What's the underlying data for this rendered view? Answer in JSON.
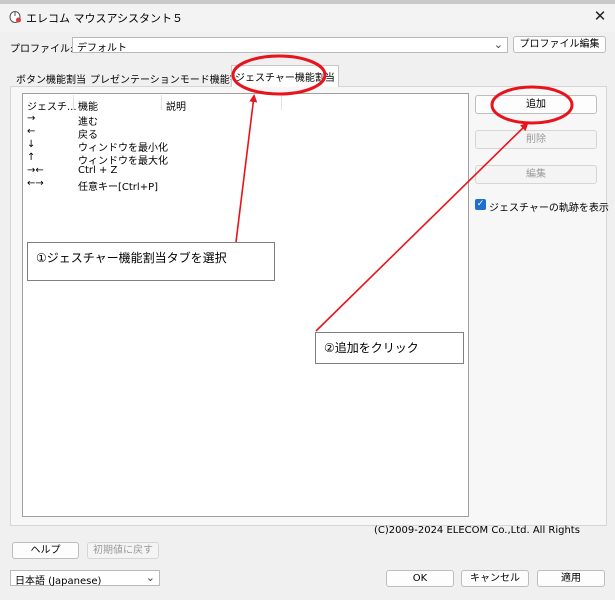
{
  "window": {
    "title": "エレコム マウスアシスタント５",
    "close_glyph": "✕"
  },
  "profile": {
    "label": "プロファイル:",
    "value": "デフォルト",
    "edit_button": "プロファイル編集"
  },
  "tabs": [
    {
      "label": "ボタン機能割当"
    },
    {
      "label": "プレゼンテーションモード機能割当"
    },
    {
      "label": "ジェスチャー機能割当"
    }
  ],
  "gesture_list": {
    "columns": [
      "ジェスチ...",
      "機能",
      "説明"
    ],
    "rows": [
      {
        "gesture": "→",
        "function": "進む",
        "description": ""
      },
      {
        "gesture": "←",
        "function": "戻る",
        "description": ""
      },
      {
        "gesture": "↓",
        "function": "ウィンドウを最小化",
        "description": ""
      },
      {
        "gesture": "↑",
        "function": "ウィンドウを最大化",
        "description": ""
      },
      {
        "gesture": "→←",
        "function": "Ctrl + Z",
        "description": ""
      },
      {
        "gesture": "←→",
        "function": "任意キー[Ctrl+P]",
        "description": ""
      }
    ]
  },
  "side_buttons": {
    "add": "追加",
    "delete": "削除",
    "edit": "編集"
  },
  "show_trail": {
    "label": "ジェスチャーの軌跡を表示",
    "checked": true
  },
  "copyright": "(C)2009-2024 ELECOM Co.,Ltd. All Rights",
  "footer": {
    "help": "ヘルプ",
    "reset": "初期値に戻す",
    "language": "日本語 (Japanese)",
    "ok": "OK",
    "cancel": "キャンセル",
    "apply": "適用"
  },
  "annotations": {
    "step1": "①ジェスチャー機能割当タブを選択",
    "step2": "②追加をクリック",
    "color": "#e8141b"
  }
}
